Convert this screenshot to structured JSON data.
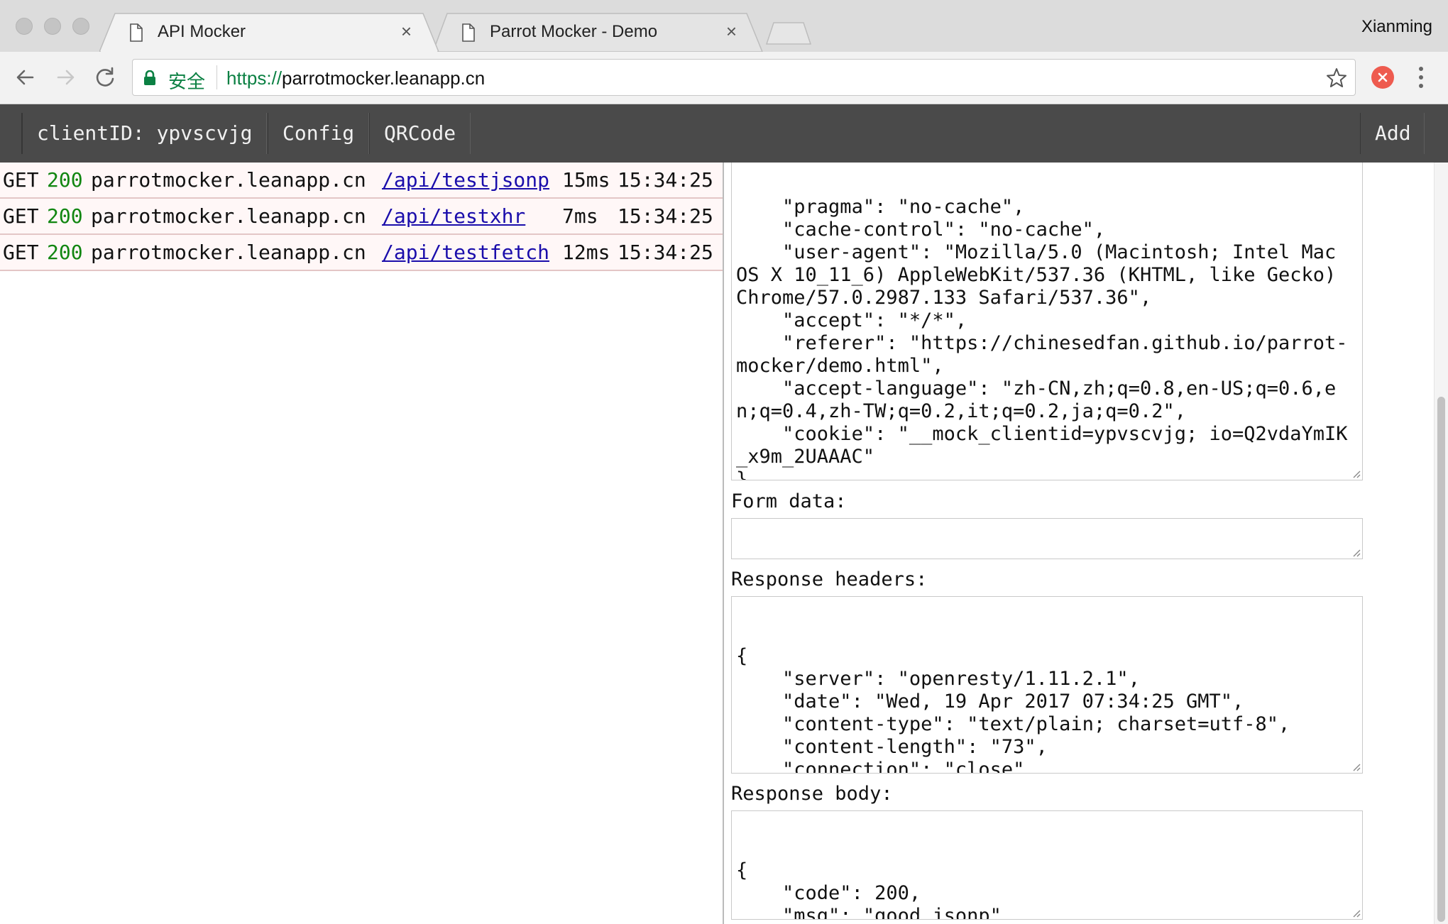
{
  "browser": {
    "tabs": [
      {
        "title": "API Mocker",
        "close": "×"
      },
      {
        "title": "Parrot Mocker - Demo",
        "close": "×"
      }
    ],
    "profile_name": "Xianming",
    "security_label": "安全",
    "url_scheme": "https://",
    "url_host": "parrotmocker.leanapp.cn",
    "icons": [
      "back-arrow-icon",
      "forward-arrow-icon",
      "reload-icon",
      "lock-icon",
      "star-icon",
      "extension-icon",
      "menu-dots-icon"
    ]
  },
  "app_nav": {
    "client_id": "clientID: ypvscvjg",
    "config": "Config",
    "qrcode": "QRCode",
    "add": "Add"
  },
  "requests": [
    {
      "method": "GET",
      "status": "200",
      "host": "parrotmocker.leanapp.cn",
      "path": "/api/testjsonp",
      "duration": "15ms",
      "time": "15:34:25"
    },
    {
      "method": "GET",
      "status": "200",
      "host": "parrotmocker.leanapp.cn",
      "path": "/api/testxhr",
      "duration": "7ms",
      "time": "15:34:25"
    },
    {
      "method": "GET",
      "status": "200",
      "host": "parrotmocker.leanapp.cn",
      "path": "/api/testfetch",
      "duration": "12ms",
      "time": "15:34:25"
    }
  ],
  "detail": {
    "request_headers_text": "    \"pragma\": \"no-cache\",\n    \"cache-control\": \"no-cache\",\n    \"user-agent\": \"Mozilla/5.0 (Macintosh; Intel Mac OS X 10_11_6) AppleWebKit/537.36 (KHTML, like Gecko) Chrome/57.0.2987.133 Safari/537.36\",\n    \"accept\": \"*/*\",\n    \"referer\": \"https://chinesedfan.github.io/parrot-mocker/demo.html\",\n    \"accept-language\": \"zh-CN,zh;q=0.8,en-US;q=0.6,en;q=0.4,zh-TW;q=0.2,it;q=0.2,ja;q=0.2\",\n    \"cookie\": \"__mock_clientid=ypvscvjg; io=Q2vdaYmIK_x9m_2UAAAC\"\n}",
    "form_data_label": "Form data:",
    "form_data_text": "{}",
    "response_headers_label": "Response headers:",
    "response_headers_text": "{\n    \"server\": \"openresty/1.11.2.1\",\n    \"date\": \"Wed, 19 Apr 2017 07:34:25 GMT\",\n    \"content-type\": \"text/plain; charset=utf-8\",\n    \"content-length\": \"73\",\n    \"connection\": \"close\"\n}",
    "response_body_label": "Response body:",
    "response_body_text": "{\n    \"code\": 200,\n    \"msg\": \"good jsonp\"\n}"
  }
}
